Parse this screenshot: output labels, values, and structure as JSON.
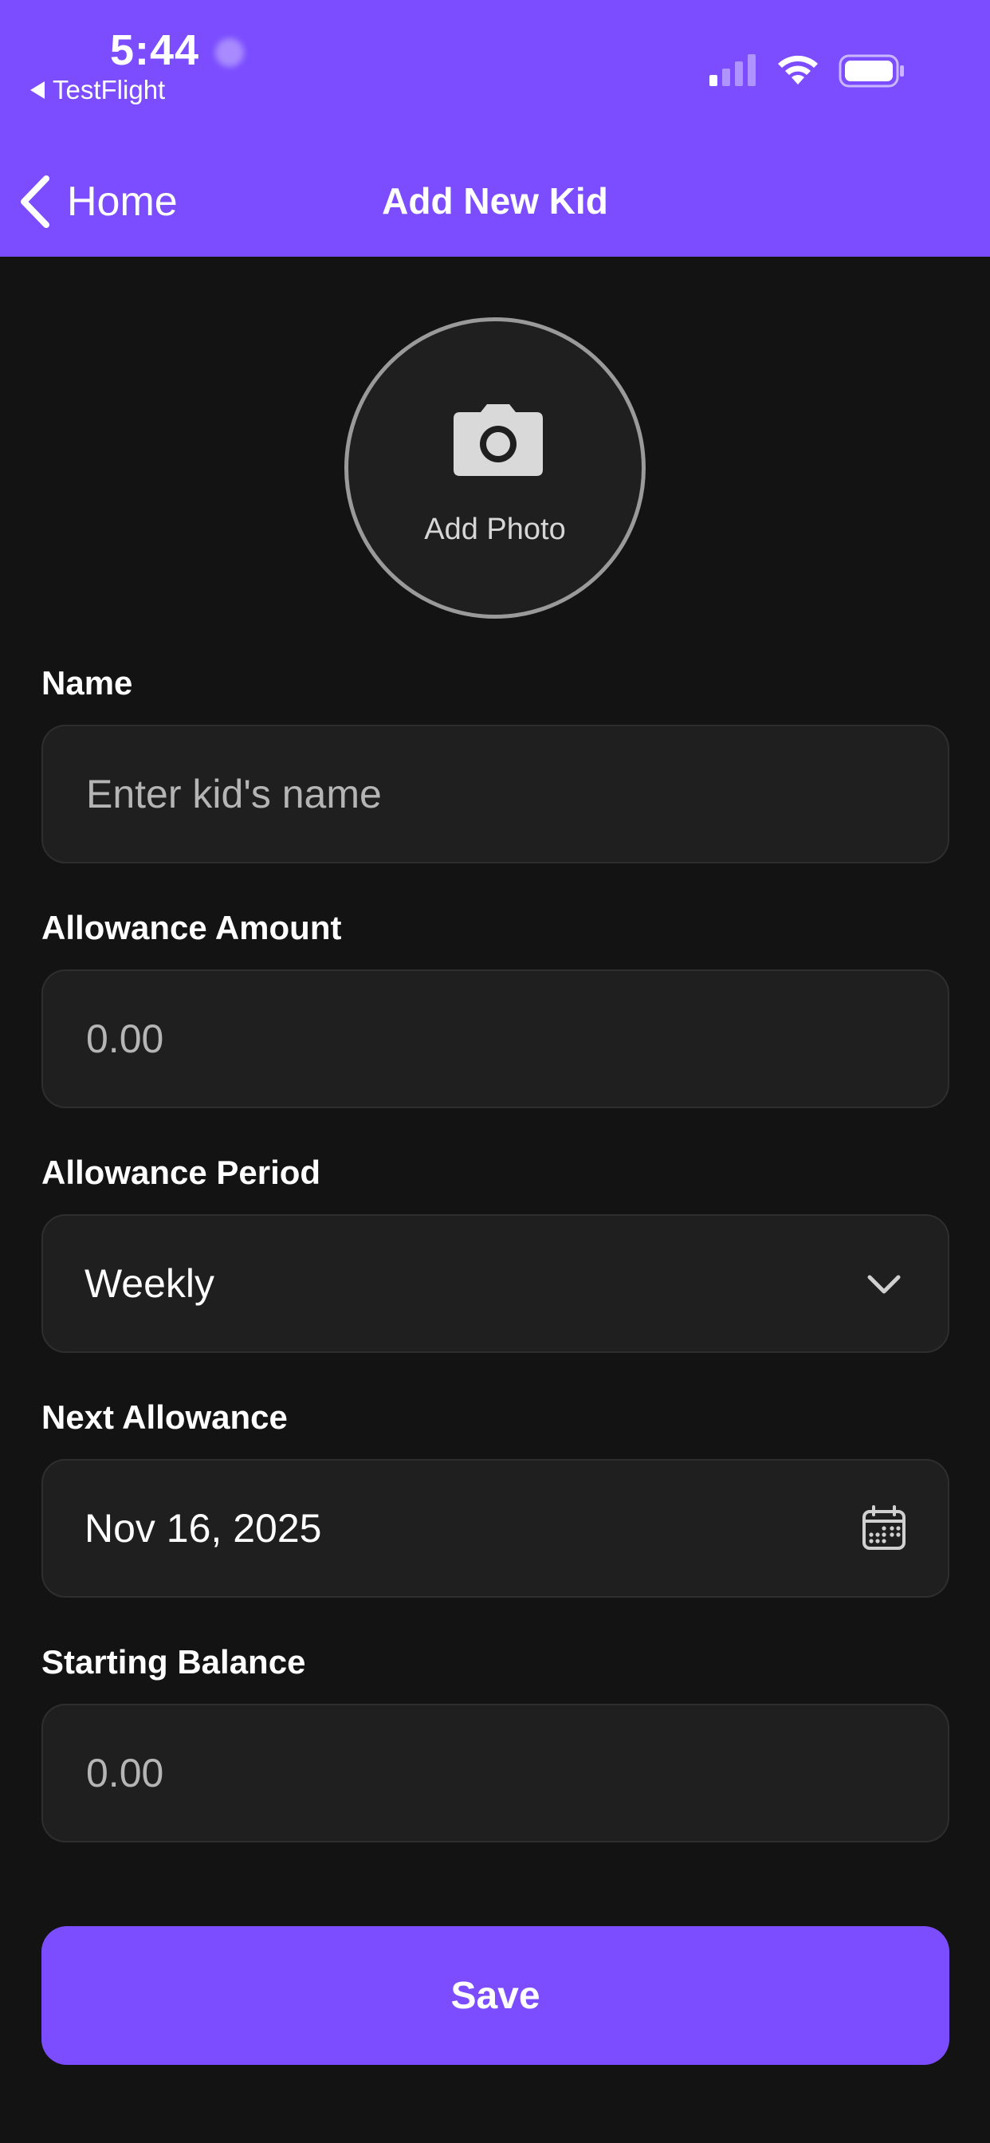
{
  "status_bar": {
    "time": "5:44",
    "back_app": "TestFlight"
  },
  "nav": {
    "back_label": "Home",
    "title": "Add New Kid"
  },
  "photo": {
    "label": "Add Photo",
    "icon": "camera-icon"
  },
  "form": {
    "name": {
      "label": "Name",
      "placeholder": "Enter kid's name",
      "value": ""
    },
    "allowance_amount": {
      "label": "Allowance Amount",
      "placeholder": "0.00",
      "value": ""
    },
    "allowance_period": {
      "label": "Allowance Period",
      "value": "Weekly",
      "icon": "chevron-down-icon"
    },
    "next_allowance": {
      "label": "Next Allowance",
      "value": "Nov 16, 2025",
      "icon": "calendar-icon"
    },
    "starting_balance": {
      "label": "Starting Balance",
      "placeholder": "0.00",
      "value": ""
    }
  },
  "actions": {
    "save_label": "Save"
  },
  "colors": {
    "accent": "#7b4dff",
    "background": "#131313",
    "field_background": "#1f1f1f"
  }
}
